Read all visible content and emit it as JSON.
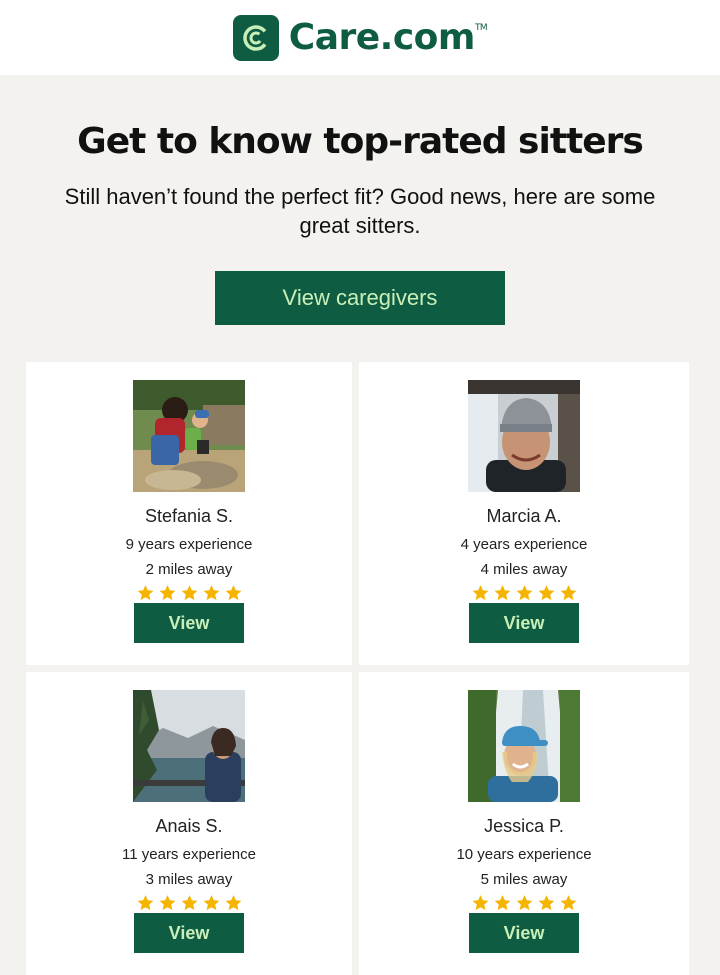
{
  "brand": {
    "name": "Care.com",
    "trademark": "TM",
    "color": "#0e5c42",
    "icon": "care-logo-icon"
  },
  "hero": {
    "title": "Get to know top-rated sitters",
    "subtitle": "Still haven’t found the perfect fit? Good news, here are some great sitters.",
    "cta_label": "View caregivers"
  },
  "colors": {
    "background": "#f3f2ee",
    "button": "#0e5c42",
    "button_text": "#c9efb9",
    "star": "#f5b400"
  },
  "caregivers": [
    {
      "name": "Stefania S.",
      "experience": "9 years experience",
      "distance": "2 miles away",
      "rating": 5,
      "button": "View",
      "photo": "outdoor-rocks-photo"
    },
    {
      "name": "Marcia A.",
      "experience": "4 years experience",
      "distance": "4 miles away",
      "rating": 5,
      "button": "View",
      "photo": "beanie-portrait-photo"
    },
    {
      "name": "Anais S.",
      "experience": "11 years experience",
      "distance": "3 miles away",
      "rating": 5,
      "button": "View",
      "photo": "lake-forest-photo"
    },
    {
      "name": "Jessica P.",
      "experience": "10 years experience",
      "distance": "5 miles away",
      "rating": 5,
      "button": "View",
      "photo": "waterfall-cap-photo"
    }
  ]
}
